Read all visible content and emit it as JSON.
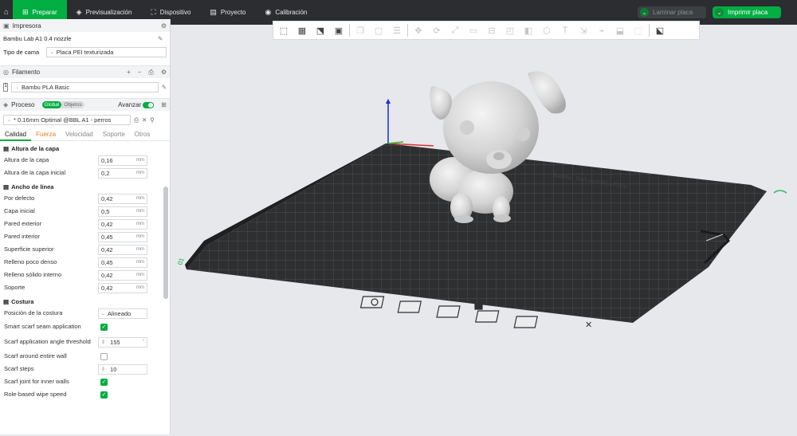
{
  "topbar": {
    "tabs": [
      {
        "label": "Preparar",
        "icon": "⊞"
      },
      {
        "label": "Previsualización",
        "icon": "◈"
      },
      {
        "label": "Dispositivo",
        "icon": "⛶"
      },
      {
        "label": "Proyecto",
        "icon": "▤"
      },
      {
        "label": "Calibración",
        "icon": "◉"
      }
    ],
    "slice_label": "Laminar placa",
    "print_label": "Imprimir placa"
  },
  "printer": {
    "title": "Impresora",
    "name": "Bambu Lab A1 0.4 nozzle",
    "bed_label": "Tipo de cama",
    "bed_value": "Placa PEI texturizada"
  },
  "filament": {
    "title": "Filamento",
    "slot": "1",
    "name": "Bambu PLA Basic"
  },
  "process": {
    "title": "Proceso",
    "toggle_global": "Global",
    "toggle_objects": "Objetos",
    "advanced": "Avanzar",
    "preset": "* 0.16mm Optimal @BBL A1 - perros",
    "tabs": [
      "Calidad",
      "Fuerza",
      "Velocidad",
      "Soporte",
      "Otros"
    ]
  },
  "groups": {
    "layer_height": {
      "title": "Altura de la capa",
      "rows": [
        {
          "label": "Altura de la capa",
          "value": "0,16",
          "unit": "mm"
        },
        {
          "label": "Altura de la capa inicial",
          "value": "0,2",
          "unit": "mm"
        }
      ]
    },
    "line_width": {
      "title": "Ancho de línea",
      "rows": [
        {
          "label": "Por defecto",
          "value": "0,42",
          "unit": "mm"
        },
        {
          "label": "Capa inicial",
          "value": "0,5",
          "unit": "mm"
        },
        {
          "label": "Pared exterior",
          "value": "0,42",
          "unit": "mm"
        },
        {
          "label": "Pared interior",
          "value": "0,45",
          "unit": "mm"
        },
        {
          "label": "Superficie superior",
          "value": "0,42",
          "unit": "mm"
        },
        {
          "label": "Relleno poco denso",
          "value": "0,45",
          "unit": "mm"
        },
        {
          "label": "Relleno sólido interno",
          "value": "0,42",
          "unit": "mm"
        },
        {
          "label": "Soporte",
          "value": "0,42",
          "unit": "mm"
        }
      ]
    },
    "seam": {
      "title": "Costura",
      "position_label": "Posición de la costura",
      "position_value": "Alineado",
      "smart_label": "Smart scarf seam application",
      "angle_label": "Scarf application angle threshold",
      "angle_value": "155",
      "angle_unit": "°",
      "around_label": "Scarf around entire wall",
      "steps_label": "Scarf steps",
      "steps_value": "10",
      "inner_label": "Scarf joint for inner walls",
      "wipe_label": "Role-based wipe speed"
    }
  },
  "bed_labels": {
    "front_text": "Bambu Textured PEI Plate",
    "plate_number": "01"
  },
  "colors": {
    "accent": "#00ae42",
    "topbar": "#2b2d30",
    "bed": "#2d2f31",
    "grid": "#56595c",
    "model": "#d9d9d9"
  }
}
